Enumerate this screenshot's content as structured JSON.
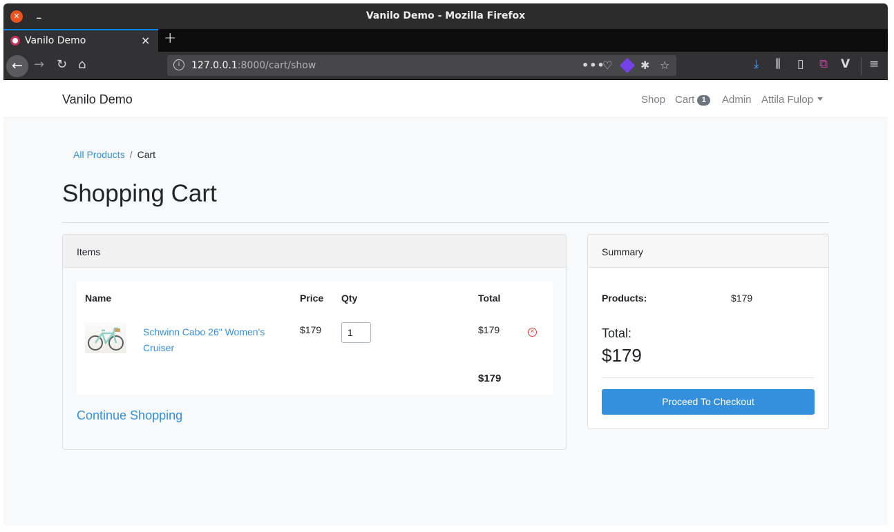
{
  "browser": {
    "window_title": "Vanilo Demo - Mozilla Firefox",
    "tab_title": "Vanilo Demo",
    "url_host": "127.0.0.1",
    "url_path": ":8000/cart/show",
    "close_glyph": "✕",
    "new_tab_glyph": "+",
    "more_glyph": "•••"
  },
  "site": {
    "brand": "Vanilo Demo",
    "nav": {
      "shop": "Shop",
      "cart": "Cart",
      "cart_count": "1",
      "admin": "Admin",
      "user": "Attila Fulop"
    }
  },
  "breadcrumb": {
    "all_products": "All Products",
    "separator": "/",
    "current": "Cart"
  },
  "page_title": "Shopping Cart",
  "items_card": {
    "header": "Items",
    "columns": {
      "name": "Name",
      "price": "Price",
      "qty": "Qty",
      "total": "Total"
    },
    "rows": [
      {
        "name": "Schwinn Cabo 26\" Women's Cruiser",
        "price": "$179",
        "qty": "1",
        "total": "$179"
      }
    ],
    "grand_total": "$179",
    "continue_label": "Continue Shopping"
  },
  "summary_card": {
    "header": "Summary",
    "products_label": "Products:",
    "products_value": "$179",
    "total_label": "Total:",
    "total_value": "$179",
    "checkout_label": "Proceed To Checkout"
  },
  "colors": {
    "link": "#3490dc",
    "primary_button": "#3490dc",
    "remove": "#e3342f",
    "badge": "#6c757d"
  },
  "icons": {
    "remove": "remove-circle-icon",
    "back": "back-arrow-icon",
    "reload": "reload-icon",
    "home": "home-icon"
  }
}
